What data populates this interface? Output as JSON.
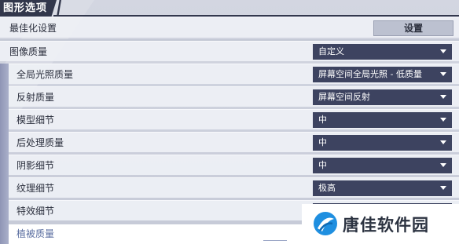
{
  "header": {
    "title": "图形选项"
  },
  "optimize": {
    "label": "最佳化设置",
    "button_label": "设置"
  },
  "image_quality": {
    "label": "图像质量",
    "value": "自定义"
  },
  "settings": [
    {
      "label": "全局光照质量",
      "value": "屏幕空间全局光照 - 低质量"
    },
    {
      "label": "反射质量",
      "value": "屏幕空间反射"
    },
    {
      "label": "模型细节",
      "value": "中"
    },
    {
      "label": "后处理质量",
      "value": "中"
    },
    {
      "label": "阴影细节",
      "value": "中"
    },
    {
      "label": "纹理细节",
      "value": "极高"
    },
    {
      "label": "特效细节",
      "value": ""
    }
  ],
  "partial_row": {
    "label": "植被质量"
  },
  "watermark": {
    "text": "唐佳软件园"
  },
  "colors": {
    "dropdown_bg": "#3d4360",
    "header_bg": "#32374c",
    "accent_sidebar": "#8f95b5"
  }
}
